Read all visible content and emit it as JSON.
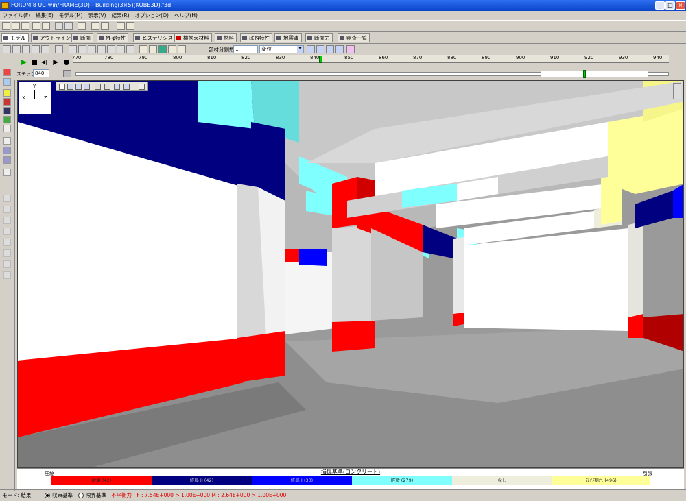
{
  "window": {
    "title": "FORUM 8  UC-win/FRAME(3D) - Building(3×5)(KOBE3D).f3d",
    "minimize": "_",
    "maximize": "□",
    "close": "×"
  },
  "menu": [
    "ファイル(F)",
    "編集(E)",
    "モデル(M)",
    "表示(V)",
    "結果(R)",
    "オプション(O)",
    "ヘルプ(H)"
  ],
  "tabs": [
    {
      "label": "モデル",
      "active": true
    },
    {
      "label": "アウトライン"
    },
    {
      "label": "断面"
    },
    {
      "label": "M-φ特性"
    },
    {
      "label": "ヒステリシス"
    },
    {
      "label": "横拘束材料"
    },
    {
      "label": "材料"
    },
    {
      "label": "ばね特性"
    },
    {
      "label": "地震波"
    },
    {
      "label": "断面力"
    },
    {
      "label": "照査一覧"
    }
  ],
  "toolbar2": {
    "division_label": "部材分割数",
    "division_value": "1",
    "display_select": "変位"
  },
  "ruler": {
    "ticks": [
      "770",
      "780",
      "790",
      "800",
      "810",
      "820",
      "830",
      "840",
      "850",
      "860",
      "870",
      "880",
      "890",
      "900",
      "910",
      "920",
      "930",
      "940"
    ]
  },
  "step": {
    "label": "ステップ",
    "value": "840"
  },
  "axes": {
    "x": "X",
    "y": "Y",
    "z": "Z"
  },
  "legend": {
    "title": "損傷基準(コンクリート)",
    "left_label": "圧縮",
    "right_label": "引張",
    "segments": [
      {
        "label": "破壊 (42)",
        "color": "#ff0000"
      },
      {
        "label": "終局 II (42)",
        "color": "#000080"
      },
      {
        "label": "終局 I (30)",
        "color": "#0000ff"
      },
      {
        "label": "軽微 (279)",
        "color": "#80ffff"
      },
      {
        "label": "なし",
        "color": "#eeeedd"
      },
      {
        "label": "ひび割れ (496)",
        "color": "#ffff99"
      }
    ]
  },
  "status": {
    "mode": "モード: 結果",
    "radio1": "収束基準",
    "radio2": "限界基準",
    "imbalance": "不平衡力 : F : 7.54E+000 > 1.00E+000 M : 2.64E+000 > 1.00E+000"
  },
  "colors": {
    "accent_red": "#ff0000",
    "navy": "#000080",
    "blue": "#0000ff",
    "cyan": "#80ffff",
    "cream": "#eeeedd",
    "yellow": "#ffff99"
  }
}
